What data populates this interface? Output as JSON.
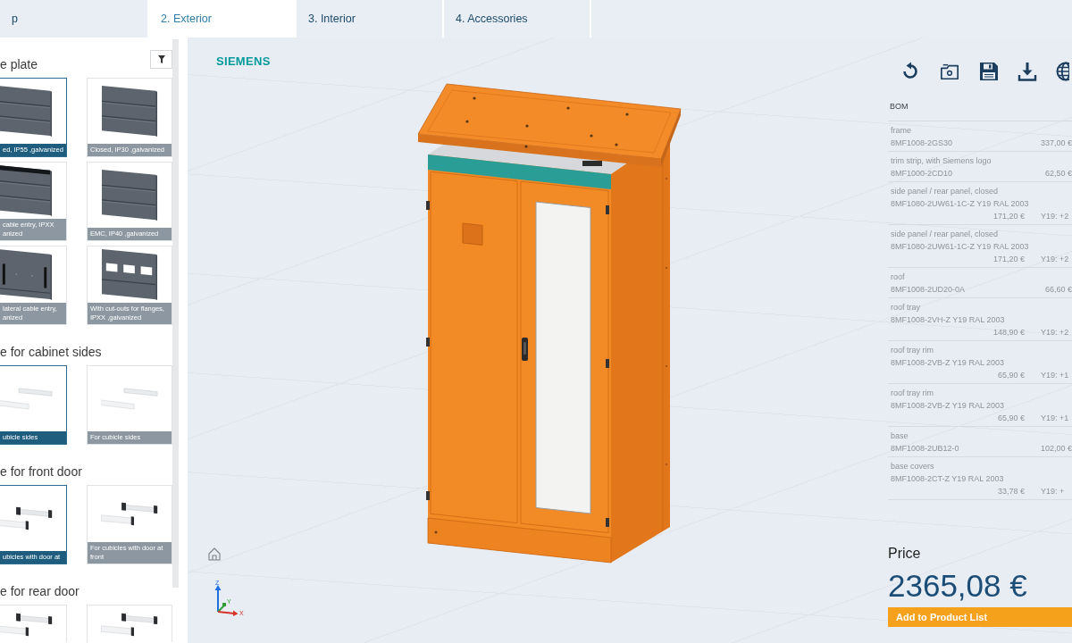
{
  "tabs": [
    {
      "label": "p",
      "selected": false
    },
    {
      "label": "2. Exterior",
      "selected": true
    },
    {
      "label": "3. Interior",
      "selected": false
    },
    {
      "label": "4. Accessories",
      "selected": false
    }
  ],
  "sidebar": {
    "sections": [
      {
        "heading": "e plate",
        "filter": true,
        "options": [
          {
            "kind": "plate",
            "caption": "ed, IP55 ,galvanized",
            "selected": true
          },
          {
            "kind": "plate",
            "caption": "Closed, IP30 ,galvanized",
            "selected": false
          },
          {
            "kind": "plate-slot",
            "caption": "cable entry, IPXX anized",
            "selected": false
          },
          {
            "kind": "plate",
            "caption": "EMC, IP40 ,galvanized",
            "selected": false
          },
          {
            "kind": "plate-lateral",
            "caption": "lateral cable entry, anized",
            "selected": false
          },
          {
            "kind": "plate-cutouts",
            "caption": "With cut-outs for flanges, IPXX ,galvanized",
            "selected": false
          }
        ]
      },
      {
        "heading": "e for cabinet sides",
        "options": [
          {
            "kind": "strips",
            "caption": "ubicle sides",
            "selected": true
          },
          {
            "kind": "strips",
            "caption": "For cubicle sides",
            "selected": false
          }
        ]
      },
      {
        "heading": "e for front door",
        "options": [
          {
            "kind": "strips-capped",
            "caption": "ubicles with door at",
            "selected": true
          },
          {
            "kind": "strips-capped",
            "caption": "For cubicles with door at front",
            "selected": false
          }
        ]
      },
      {
        "heading": "e for rear door",
        "options": [
          {
            "kind": "strips-capped",
            "selected": false
          },
          {
            "kind": "strips-capped",
            "selected": false
          }
        ]
      }
    ]
  },
  "viewport": {
    "logo": "SIEMENS",
    "axis_labels": {
      "x": "X",
      "y": "Y",
      "z": "Z"
    }
  },
  "bom": {
    "title": "BOM",
    "items": [
      {
        "name": "frame",
        "code": "8MF1008-2GS30",
        "price": "337,00 €"
      },
      {
        "name": "trim strip, with Siemens logo",
        "code": "8MF1000-2CD10",
        "price": "62,50 €"
      },
      {
        "name": "side panel / rear panel, closed",
        "code": "8MF1080-2UW61-1C-Z Y19 RAL 2003",
        "price": "171,20 €",
        "surcharge": "Y19: +2"
      },
      {
        "name": "side panel / rear panel, closed",
        "code": "8MF1080-2UW61-1C-Z Y19 RAL 2003",
        "price": "171,20 €",
        "surcharge": "Y19: +2"
      },
      {
        "name": "roof",
        "code": "8MF1008-2UD20-0A",
        "price": "66,60 €"
      },
      {
        "name": "roof tray",
        "code": "8MF1008-2VH-Z Y19 RAL 2003",
        "price": "148,90 €",
        "surcharge": "Y19: +2"
      },
      {
        "name": "roof tray rim",
        "code": "8MF1008-2VB-Z Y19 RAL 2003",
        "price": "65,90 €",
        "surcharge": "Y19: +1"
      },
      {
        "name": "roof tray rim",
        "code": "8MF1008-2VB-Z Y19 RAL 2003",
        "price": "65,90 €",
        "surcharge": "Y19: +1"
      },
      {
        "name": "base",
        "code": "8MF1008-2UB12-0",
        "price": "102,00 €"
      },
      {
        "name": "base covers",
        "code": "8MF1008-2CT-Z Y19 RAL 2003",
        "price": "33,78 €",
        "surcharge": "Y19: +"
      }
    ]
  },
  "price": {
    "label": "Price",
    "amount": "2365,08 €"
  },
  "add_button": "Add to Product List"
}
